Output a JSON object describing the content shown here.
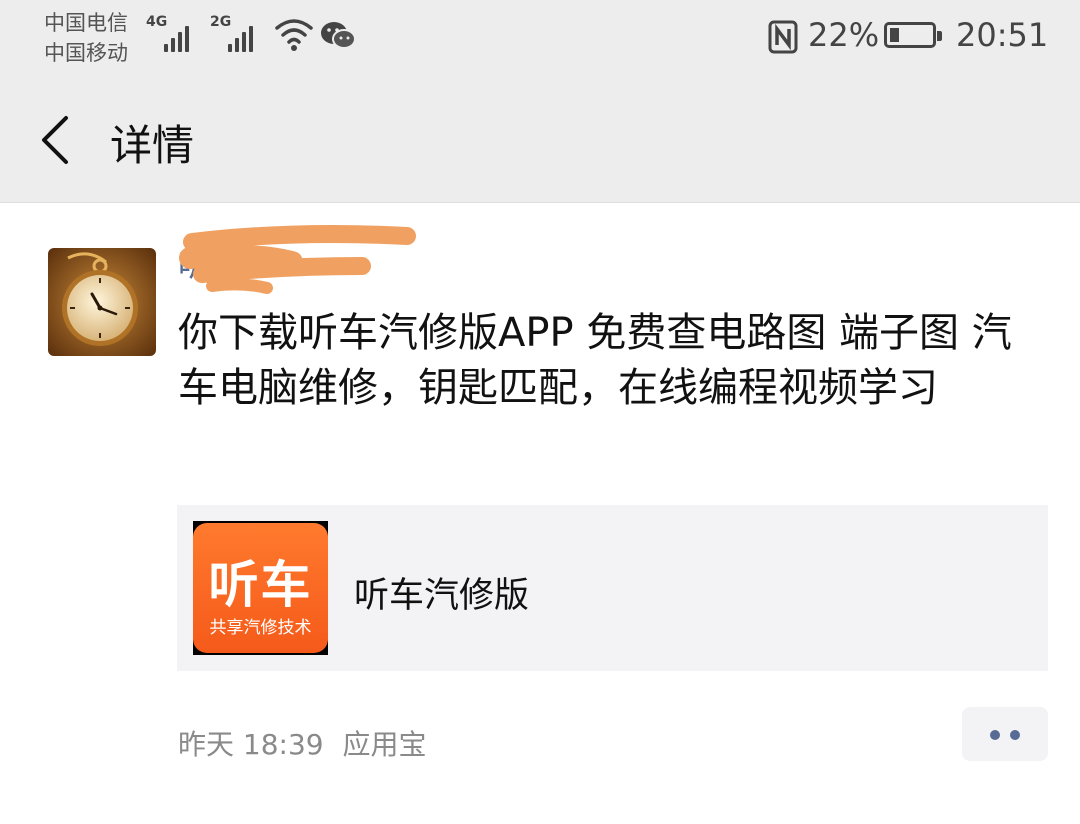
{
  "status_bar": {
    "carrier_1": "中国电信",
    "carrier_2": "中国移动",
    "network_1": "4G",
    "network_2": "2G",
    "battery_percent": "22%",
    "battery_level": 0.22,
    "time": "20:51",
    "icons": [
      "signal-icon",
      "wifi-icon",
      "wechat-icon",
      "nfc-icon",
      "battery-icon"
    ]
  },
  "nav": {
    "title": "详情",
    "back_icon": "chevron-left-icon"
  },
  "post": {
    "username": "听车",
    "content": "你下载听车汽修版APP  免费查电路图 端子图 汽车电脑维修，钥匙匹配，在线编程视频学习",
    "card": {
      "icon_text": "听车",
      "icon_subtext": "共享汽修技术",
      "title": "听车汽修版"
    },
    "time": "昨天 18:39",
    "source": "应用宝"
  },
  "colors": {
    "header_bg": "#ededed",
    "link": "#576b95",
    "card_bg": "#f3f3f5",
    "brand_orange": "#f55a1a"
  }
}
